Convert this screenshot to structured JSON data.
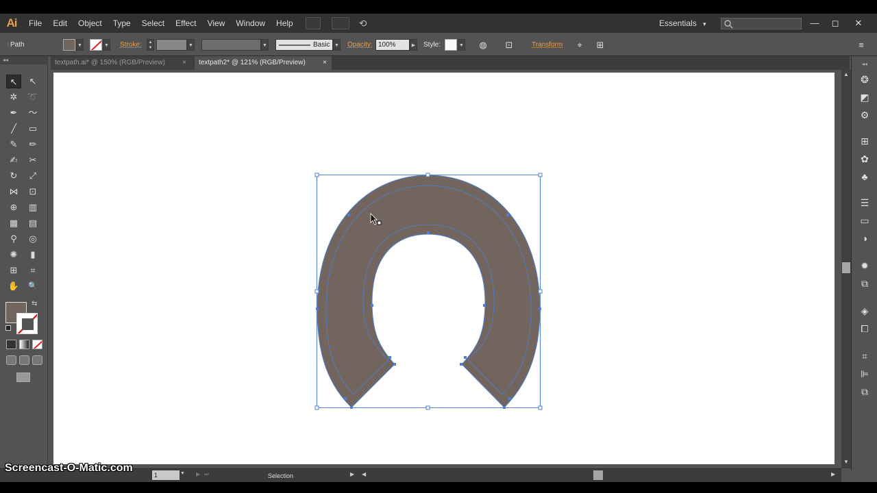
{
  "app": {
    "logo": "Ai"
  },
  "menu": [
    "File",
    "Edit",
    "Object",
    "Type",
    "Select",
    "Effect",
    "View",
    "Window",
    "Help"
  ],
  "workspace": {
    "label": "Essentials",
    "arrow": "▾"
  },
  "window_controls": {
    "minimize": "—",
    "maximize": "◻",
    "close": "✕"
  },
  "control_bar": {
    "selection_type": "Path",
    "fill_color": "#71655e",
    "stroke_label": "Stroke:",
    "brush_label": "Basic",
    "opacity_label": "Opacity:",
    "opacity_value": "100%",
    "style_label": "Style:",
    "transform_label": "Transform"
  },
  "tabs": [
    {
      "label": "textpath.ai* @ 150% (RGB/Preview)",
      "close": "×",
      "active": false
    },
    {
      "label": "textpath2* @ 121% (RGB/Preview)",
      "close": "×",
      "active": true
    }
  ],
  "toolbox": {
    "fill_color": "#71655e",
    "stroke_color": "none",
    "tools": [
      {
        "name": "selection-tool-icon",
        "glyph": "↖"
      },
      {
        "name": "direct-selection-tool-icon",
        "glyph": "↖"
      },
      {
        "name": "magic-wand-tool-icon",
        "glyph": "✲"
      },
      {
        "name": "lasso-tool-icon",
        "glyph": "➰"
      },
      {
        "name": "pen-tool-icon",
        "glyph": "✒"
      },
      {
        "name": "curvature-tool-icon",
        "glyph": "〜"
      },
      {
        "name": "line-segment-tool-icon",
        "glyph": "╱"
      },
      {
        "name": "rectangle-tool-icon",
        "glyph": "▭"
      },
      {
        "name": "paintbrush-tool-icon",
        "glyph": "✎"
      },
      {
        "name": "pencil-tool-icon",
        "glyph": "✏"
      },
      {
        "name": "blob-brush-tool-icon",
        "glyph": "✍"
      },
      {
        "name": "scissors-tool-icon",
        "glyph": "✂"
      },
      {
        "name": "rotate-tool-icon",
        "glyph": "↻"
      },
      {
        "name": "scale-tool-icon",
        "glyph": "⤢"
      },
      {
        "name": "width-tool-icon",
        "glyph": "⋈"
      },
      {
        "name": "free-transform-tool-icon",
        "glyph": "⊡"
      },
      {
        "name": "shape-builder-tool-icon",
        "glyph": "⊕"
      },
      {
        "name": "perspective-grid-tool-icon",
        "glyph": "▥"
      },
      {
        "name": "mesh-tool-icon",
        "glyph": "▦"
      },
      {
        "name": "gradient-tool-icon",
        "glyph": "▤"
      },
      {
        "name": "eyedropper-tool-icon",
        "glyph": "⚲"
      },
      {
        "name": "blend-tool-icon",
        "glyph": "◎"
      },
      {
        "name": "symbol-sprayer-tool-icon",
        "glyph": "✺"
      },
      {
        "name": "column-graph-tool-icon",
        "glyph": "▮"
      },
      {
        "name": "artboard-tool-icon",
        "glyph": "⊞"
      },
      {
        "name": "slice-tool-icon",
        "glyph": "⌗"
      },
      {
        "name": "hand-tool-icon",
        "glyph": "✋"
      },
      {
        "name": "zoom-tool-icon",
        "glyph": "🔍"
      }
    ]
  },
  "artwork": {
    "shape_fill": "#71655e",
    "selection_color": "#4d7fd4"
  },
  "status_bar": {
    "zoom": "1",
    "tool": "Selection"
  },
  "watermark": "Screencast-O-Matic.com"
}
